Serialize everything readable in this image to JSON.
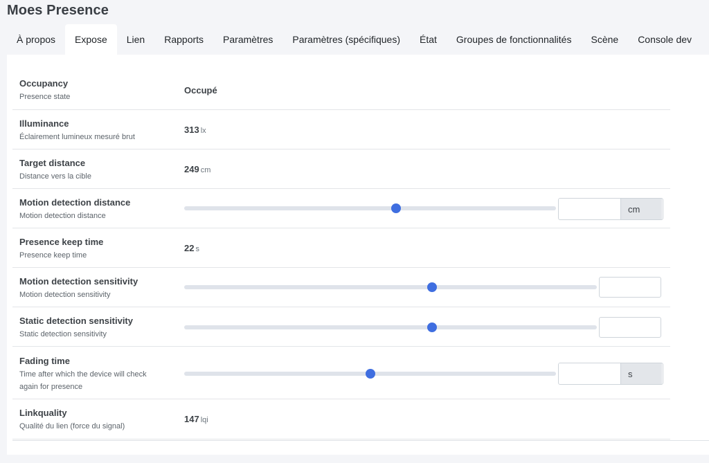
{
  "device_title": "Moes Presence",
  "tabs": [
    {
      "label": "À propos"
    },
    {
      "label": "Expose"
    },
    {
      "label": "Lien"
    },
    {
      "label": "Rapports"
    },
    {
      "label": "Paramètres"
    },
    {
      "label": "Paramètres (spécifiques)"
    },
    {
      "label": "État"
    },
    {
      "label": "Groupes de fonctionnalités"
    },
    {
      "label": "Scène"
    },
    {
      "label": "Console dev"
    }
  ],
  "active_tab": "Expose",
  "features": {
    "occupancy": {
      "label": "Occupancy",
      "desc": "Presence state",
      "value": "Occupé"
    },
    "illuminance": {
      "label": "Illuminance",
      "desc": "Éclairement lumineux mesuré brut",
      "value": "313",
      "unit": "lx"
    },
    "target_distance": {
      "label": "Target distance",
      "desc": "Distance vers la cible",
      "value": "249",
      "unit": "cm"
    },
    "motion_detection_distance": {
      "label": "Motion detection distance",
      "desc": "Motion detection distance",
      "input_value": "",
      "unit": "cm",
      "slider_fraction": 0.57
    },
    "presence_keep_time": {
      "label": "Presence keep time",
      "desc": "Presence keep time",
      "value": "22",
      "unit": "s"
    },
    "motion_detection_sensitivity": {
      "label": "Motion detection sensitivity",
      "desc": "Motion detection sensitivity",
      "input_value": "",
      "slider_fraction": 0.6
    },
    "static_detection_sensitivity": {
      "label": "Static detection sensitivity",
      "desc": "Static detection sensitivity",
      "input_value": "",
      "slider_fraction": 0.6
    },
    "fading_time": {
      "label": "Fading time",
      "desc_line1": "Time after which the device will check",
      "desc_line2": "again for presence",
      "input_value": "",
      "unit": "s",
      "slider_fraction": 0.5
    },
    "linkquality": {
      "label": "Linkquality",
      "desc": "Qualité du lien (force du signal)",
      "value": "147",
      "unit": "lqi"
    }
  },
  "colors": {
    "accent": "#3f6ee0",
    "slider_track": "#dfe3ea",
    "addon_bg": "#e3e6ea"
  }
}
